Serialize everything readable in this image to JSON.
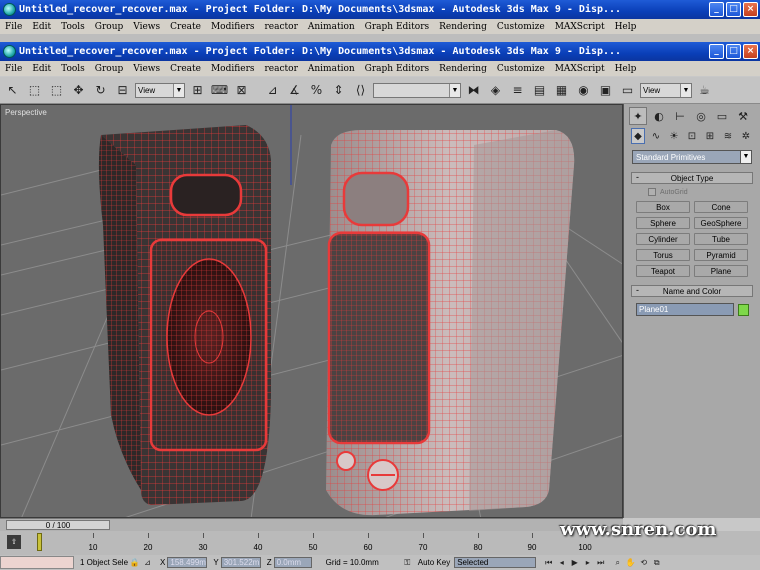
{
  "windows": [
    {
      "title": "Untitled_recover_recover.max  - Project Folder: D:\\My Documents\\3dsmax   - Autodesk 3ds Max 9   - Disp...",
      "menu": [
        "File",
        "Edit",
        "Tools",
        "Group",
        "Views",
        "Create",
        "Modifiers",
        "reactor",
        "Animation",
        "Graph Editors",
        "Rendering",
        "Customize",
        "MAXScript",
        "Help"
      ]
    },
    {
      "title": "Untitled_recover_recover.max  - Project Folder: D:\\My Documents\\3dsmax   - Autodesk 3ds Max 9   - Disp...",
      "menu": [
        "File",
        "Edit",
        "Tools",
        "Group",
        "Views",
        "Create",
        "Modifiers",
        "reactor",
        "Animation",
        "Graph Editors",
        "Rendering",
        "Customize",
        "MAXScript",
        "Help"
      ]
    }
  ],
  "window_buttons": {
    "minimize": "_",
    "maximize": "□",
    "close": "×"
  },
  "toolbar": {
    "coord_system": "View",
    "right_coord_system": "View",
    "selection_set": ""
  },
  "viewport": {
    "label": "Perspective",
    "background": "#6b6b6b",
    "wire_color": "#e83a3a"
  },
  "command_panel": {
    "category": "Standard Primitives",
    "object_type_title": "Object Type",
    "autogrid_label": "AutoGrid",
    "primitives": [
      "Box",
      "Cone",
      "Sphere",
      "GeoSphere",
      "Cylinder",
      "Tube",
      "Torus",
      "Pyramid",
      "Teapot",
      "Plane"
    ],
    "name_color_title": "Name and Color",
    "object_name": "Plane01",
    "object_color": "#7ed84a"
  },
  "timeline": {
    "slider_text": "0 / 100",
    "ticks": [
      "10",
      "20",
      "30",
      "40",
      "50",
      "60",
      "70",
      "80",
      "90",
      "100"
    ]
  },
  "status": {
    "selection": "1 Object Sele",
    "x_label": "X",
    "x_value": "158.499m",
    "y_label": "Y",
    "y_value": "301.522m",
    "z_label": "Z",
    "z_value": "0.0mm",
    "grid": "Grid = 10.0mm",
    "auto_key": "Auto Key",
    "key_mode": "Selected"
  },
  "watermark": "www.snren.com"
}
